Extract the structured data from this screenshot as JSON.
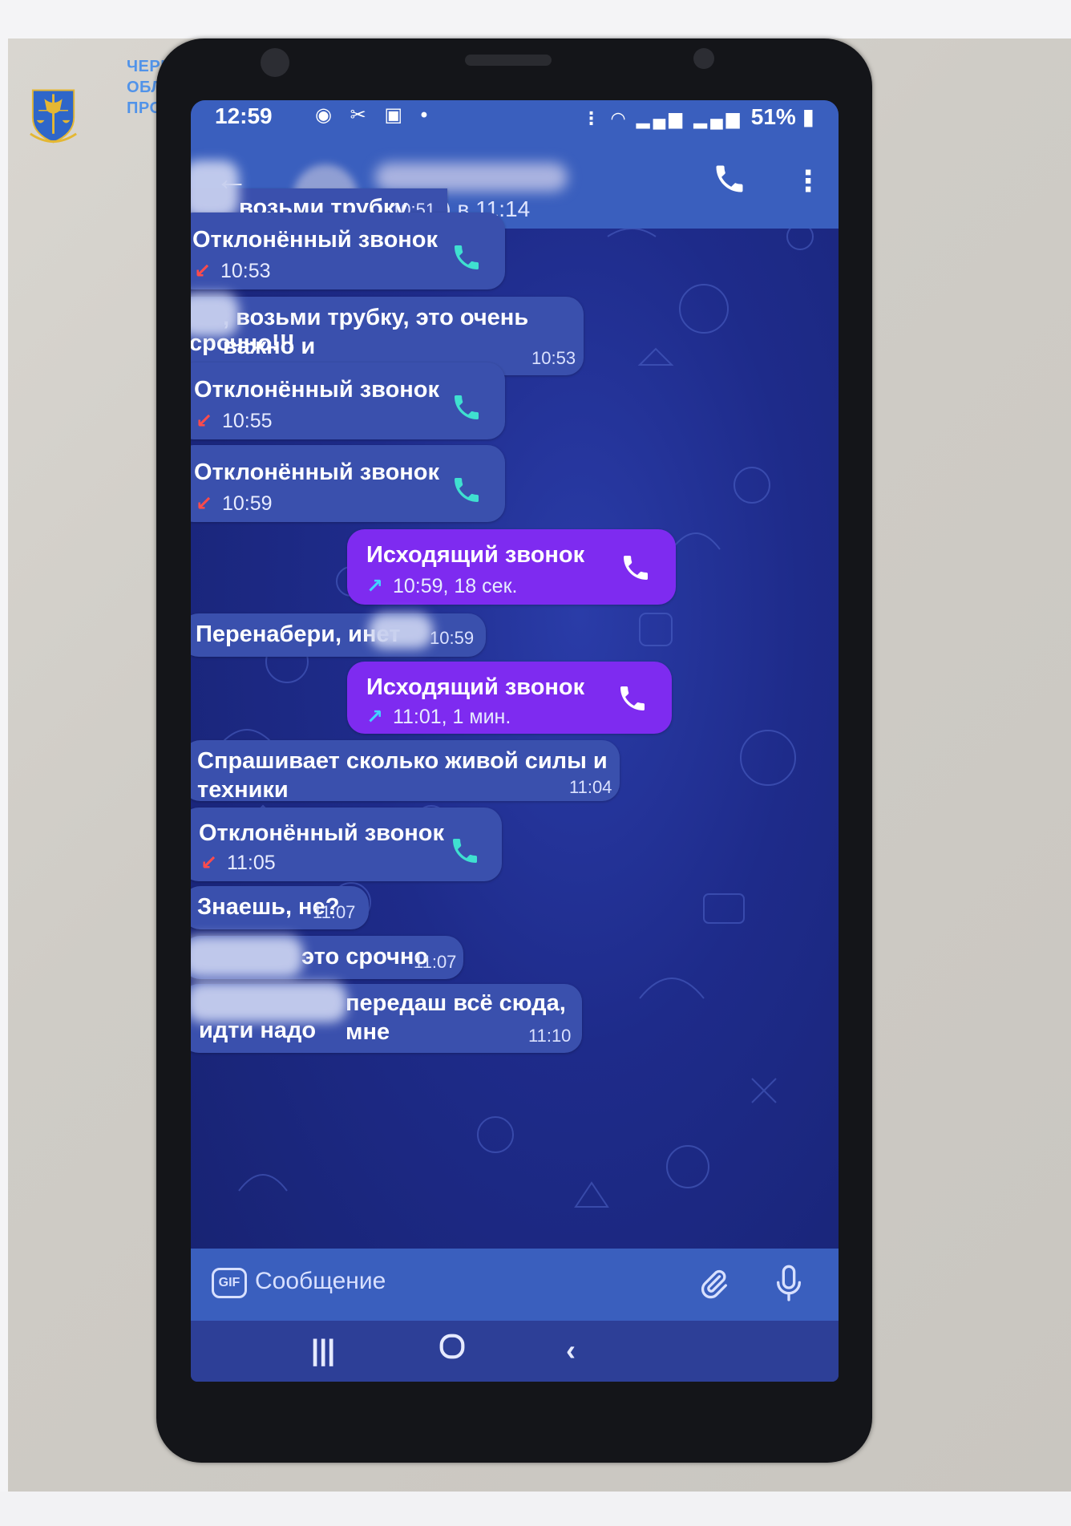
{
  "logo": {
    "lines": [
      "ЧЕРКАСЬКА",
      "ОБЛАСНА",
      "ПРОКУРАТУРА"
    ]
  },
  "status_bar": {
    "time": "12:59",
    "battery": "51%"
  },
  "chat_header": {
    "last_seen": "был(а) в 11:14"
  },
  "messages": [
    {
      "kind": "text",
      "text": "возьми трубку",
      "time": "10:51"
    },
    {
      "kind": "call",
      "title": "Отклонённый звонок",
      "meta": "10:53"
    },
    {
      "kind": "text",
      "text": ", возьми трубку, это очень важно и срочно!!!",
      "line1": ", возьми трубку, это очень важно и",
      "line2": "срочно!!!",
      "time": "10:53"
    },
    {
      "kind": "call",
      "title": "Отклонённый звонок",
      "meta": "10:55"
    },
    {
      "kind": "call",
      "title": "Отклонённый звонок",
      "meta": "10:59"
    },
    {
      "kind": "call_out",
      "title": "Исходящий звонок",
      "meta": "10:59, 18 сек."
    },
    {
      "kind": "text",
      "text": "Перенабери, инет",
      "time": "10:59"
    },
    {
      "kind": "call_out",
      "title": "Исходящий звонок",
      "meta": "11:01, 1 мин."
    },
    {
      "kind": "text",
      "text": "Спрашивает сколько живой силы и техники",
      "time": "11:04"
    },
    {
      "kind": "call",
      "title": "Отклонённый звонок",
      "meta": "11:05"
    },
    {
      "kind": "text",
      "text": "Знаешь, не?",
      "time": "11:07"
    },
    {
      "kind": "text",
      "text": "это срочно",
      "time": "11:07"
    },
    {
      "kind": "text",
      "line1": "передаш всё сюда, мне",
      "line2": "идти надо",
      "time": "11:10"
    }
  ],
  "input": {
    "placeholder": "Сообщение",
    "gif_label": "GIF"
  },
  "colors": {
    "header": "#3a5fbe",
    "incoming_bubble": "#3a50ad",
    "outgoing_bubble": "#7e2bf0",
    "call_icon": "#3fe0d0",
    "missed_arrow": "#ff4b4b",
    "outgoing_arrow": "#42d3ff"
  }
}
